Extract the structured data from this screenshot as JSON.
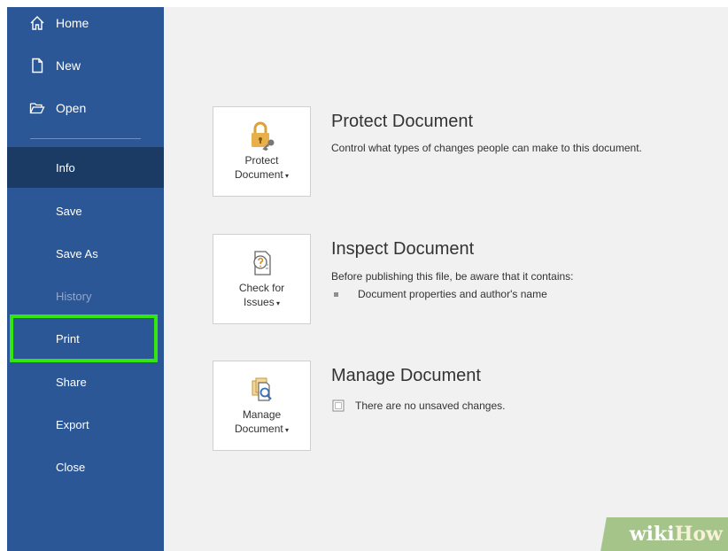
{
  "sidebar": {
    "top_items": [
      {
        "label": "Home",
        "icon": "home-icon"
      },
      {
        "label": "New",
        "icon": "new-doc-icon"
      },
      {
        "label": "Open",
        "icon": "folder-open-icon"
      }
    ],
    "items": [
      {
        "label": "Info",
        "state": "active"
      },
      {
        "label": "Save",
        "state": "normal"
      },
      {
        "label": "Save As",
        "state": "normal"
      },
      {
        "label": "History",
        "state": "disabled"
      },
      {
        "label": "Print",
        "state": "highlighted"
      },
      {
        "label": "Share",
        "state": "normal"
      },
      {
        "label": "Export",
        "state": "normal"
      },
      {
        "label": "Close",
        "state": "normal"
      }
    ]
  },
  "main": {
    "sections": [
      {
        "button_line1": "Protect",
        "button_line2": "Document",
        "button_icon": "lock-key-icon",
        "title": "Protect Document",
        "description": "Control what types of changes people can make to this document."
      },
      {
        "button_line1": "Check for",
        "button_line2": "Issues",
        "button_icon": "inspect-document-icon",
        "title": "Inspect Document",
        "description": "Before publishing this file, be aware that it contains:",
        "bullet": "Document properties and author's name"
      },
      {
        "button_line1": "Manage",
        "button_line2": "Document",
        "button_icon": "manage-document-icon",
        "title": "Manage Document",
        "bullet": "There are no unsaved changes."
      }
    ]
  },
  "watermark": {
    "part1": "wiki",
    "part2": "How"
  },
  "colors": {
    "sidebar": "#2b5797",
    "sidebar_active": "#1b3a64",
    "highlight": "#33e612",
    "main_bg": "#f1f1f1"
  }
}
